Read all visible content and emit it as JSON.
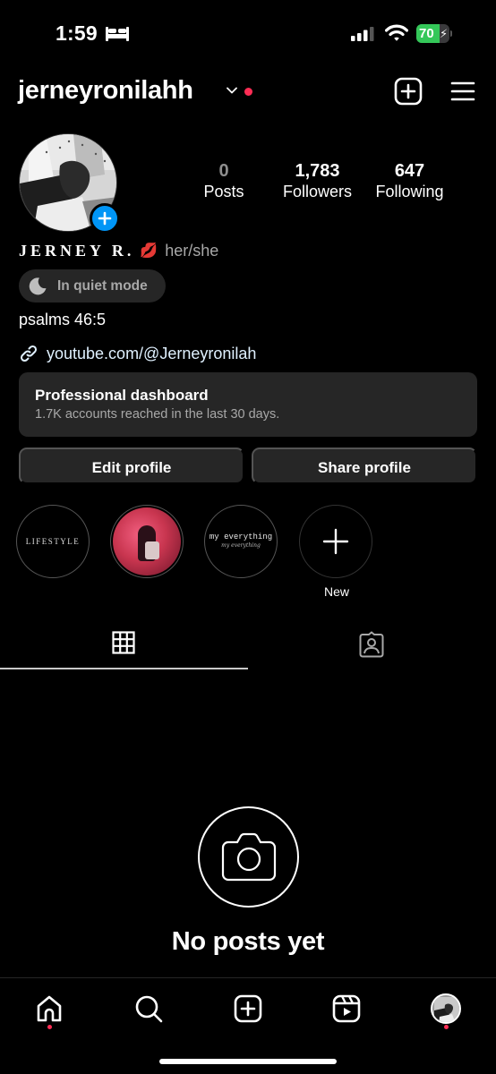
{
  "status_bar": {
    "time": "1:59",
    "focus_icon": "bed-icon",
    "signal_icon": "cellular-signal-icon",
    "wifi_icon": "wifi-icon",
    "battery_percent": "70",
    "battery_level": 0.7,
    "battery_charging": true,
    "battery_color": "#34c759"
  },
  "header": {
    "username": "jerneyronilahh",
    "account_switcher_icon": "chevron-down-icon",
    "notification_dot_color": "#ff2d55",
    "create_icon": "plus-square-icon",
    "menu_icon": "hamburger-menu-icon"
  },
  "profile": {
    "add_story_icon": "plus-icon",
    "add_story_color": "#0095f6",
    "stats": [
      {
        "value": "0",
        "label": "Posts"
      },
      {
        "value": "1,783",
        "label": "Followers"
      },
      {
        "value": "647",
        "label": "Following"
      }
    ],
    "display_name": "JERNEY R.",
    "name_emoji": "💋",
    "pronouns": "her/she",
    "quiet_mode_label": "In quiet mode",
    "bio": "psalms 46:5",
    "link": "youtube.com/@Jerneyronilah"
  },
  "dashboard": {
    "title": "Professional dashboard",
    "subtitle": "1.7K accounts reached in the last 30 days."
  },
  "actions": {
    "edit_label": "Edit profile",
    "share_label": "Share profile"
  },
  "highlights": [
    {
      "title": "LIFESTYLE",
      "label": ""
    },
    {
      "title": "",
      "label": ""
    },
    {
      "title": "my everything",
      "subtitle": "my everything",
      "label": ""
    },
    {
      "title": "",
      "label": "New"
    }
  ],
  "tabs": [
    {
      "name": "posts-grid",
      "icon": "grid-icon",
      "active": true
    },
    {
      "name": "tagged",
      "icon": "tagged-person-icon",
      "active": false
    }
  ],
  "empty_state": {
    "icon": "camera-icon",
    "title": "No posts yet"
  },
  "bottom_nav": [
    {
      "name": "home",
      "icon": "home-icon",
      "has_dot": true
    },
    {
      "name": "search",
      "icon": "search-icon",
      "has_dot": false
    },
    {
      "name": "create",
      "icon": "plus-square-icon",
      "has_dot": false
    },
    {
      "name": "reels",
      "icon": "reels-icon",
      "has_dot": false
    },
    {
      "name": "profile",
      "icon": "profile-avatar",
      "has_dot": true
    }
  ]
}
